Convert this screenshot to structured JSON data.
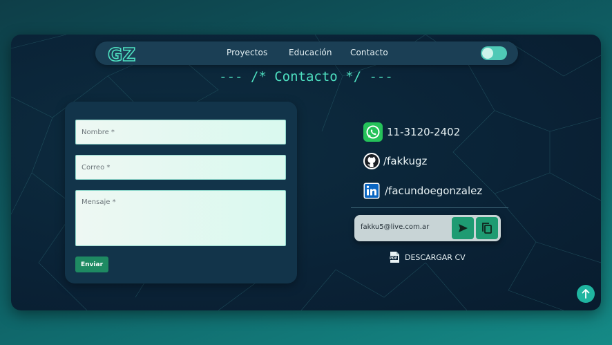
{
  "nav": {
    "logo_text": "GZ",
    "items": [
      "Proyectos",
      "Educación",
      "Contacto"
    ],
    "accent": "#4ee0c0"
  },
  "section": {
    "title": "--- /* Contacto */ ---"
  },
  "form": {
    "name_placeholder": "Nombre *",
    "email_placeholder": "Correo *",
    "message_placeholder": "Mensaje *",
    "send_label": "Enviar"
  },
  "contact": {
    "whatsapp": "11-3120-2402",
    "github": "/fakkugz",
    "linkedin": "/facundoegonzalez",
    "email": "fakku5@live.com.ar",
    "cv_label": "DESCARGAR CV"
  },
  "icons": {
    "whatsapp": "whatsapp-icon",
    "github": "github-icon",
    "linkedin": "linkedin-icon",
    "send": "send-icon",
    "copy": "copy-icon",
    "pdf": "pdf-icon",
    "scroll_top": "arrow-up-icon"
  },
  "colors": {
    "frame_bg": "#0a2236",
    "card_bg": "#12344a",
    "button_green": "#1e8a62",
    "whatsapp_green": "#25c25a",
    "linkedin_blue": "#0a66c2"
  }
}
